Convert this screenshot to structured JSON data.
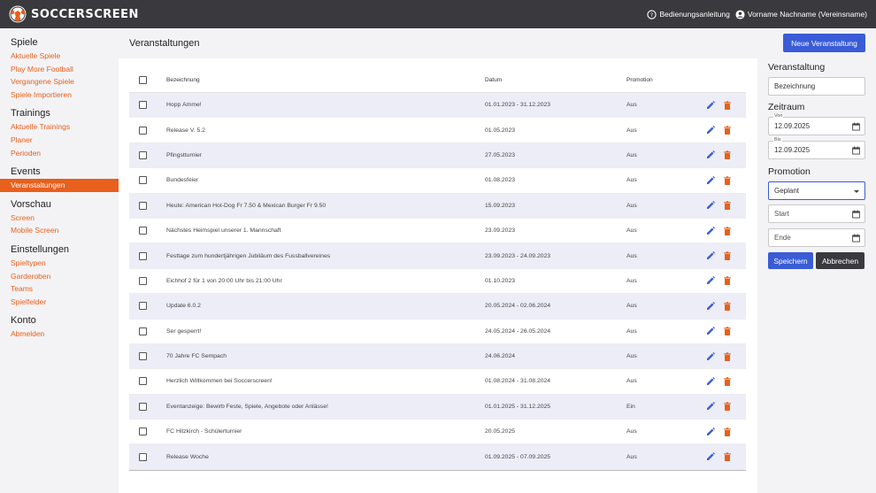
{
  "app": {
    "brand": "SOCCERSCREEN"
  },
  "topbar": {
    "manual": "Bedienungsanleitung",
    "user": "Vorname Nachname (Vereinsname)"
  },
  "sidebar": {
    "groups": [
      {
        "title": "Spiele",
        "items": [
          "Aktuelle Spiele",
          "Play More Football",
          "Vergangene Spiele",
          "Spiele Importieren"
        ]
      },
      {
        "title": "Trainings",
        "items": [
          "Aktuelle Trainings",
          "Planer",
          "Perioden"
        ]
      },
      {
        "title": "Events",
        "items": [
          "Veranstaltungen"
        ]
      },
      {
        "title": "Vorschau",
        "items": [
          "Screen",
          "Mobile Screen"
        ]
      },
      {
        "title": "Einstellungen",
        "items": [
          "Spieltypen",
          "Garderoben",
          "Teams",
          "Spielfelder"
        ]
      },
      {
        "title": "Konto",
        "items": [
          "Abmelden"
        ]
      }
    ]
  },
  "main": {
    "title": "Veranstaltungen",
    "new_button": "Neue Veranstaltung",
    "columns": {
      "name": "Bezeichnung",
      "date": "Datum",
      "promo": "Promotion"
    },
    "rows": [
      {
        "name": "Hopp Ämme!",
        "date": "01.01.2023 - 31.12.2023",
        "promo": "Aus"
      },
      {
        "name": "Release V. 5.2",
        "date": "01.05.2023",
        "promo": "Aus"
      },
      {
        "name": "Pfingstturnier",
        "date": "27.05.2023",
        "promo": "Aus"
      },
      {
        "name": "Bundesfeier",
        "date": "01.08.2023",
        "promo": "Aus"
      },
      {
        "name": "Heute: American Hot-Dog Fr 7.50 & Mexican Burger Fr 9.50",
        "date": "15.09.2023",
        "promo": "Aus"
      },
      {
        "name": "Nächstes Heimspiel unserer 1. Mannschaft",
        "date": "23.09.2023",
        "promo": "Aus"
      },
      {
        "name": "Festtage zum hundertjährigen Jubiläum des Fussballvereines",
        "date": "23.09.2023 - 24.09.2023",
        "promo": "Aus"
      },
      {
        "name": "Eichhof 2 für 1 von 20:00 Uhr bis 21:00 Uhr",
        "date": "01.10.2023",
        "promo": "Aus"
      },
      {
        "name": "Update 6.0.2",
        "date": "20.05.2024 - 02.06.2024",
        "promo": "Aus"
      },
      {
        "name": "Ser gesperrt!",
        "date": "24.05.2024 - 26.05.2024",
        "promo": "Aus"
      },
      {
        "name": "70 Jahre FC Sempach",
        "date": "24.06.2024",
        "promo": "Aus"
      },
      {
        "name": "Herzlich Willkommen bei Soccerscreen!",
        "date": "01.08.2024 - 31.08.2024",
        "promo": "Aus"
      },
      {
        "name": "Eventanzeige: Bewirb Feste, Spiele, Angebote oder Anlässe!",
        "date": "01.01.2025 - 31.12.2025",
        "promo": "Ein"
      },
      {
        "name": "FC Hitzkirch - Schülerturnier",
        "date": "20.05.2025",
        "promo": "Aus"
      },
      {
        "name": "Release Woche",
        "date": "01.09.2025 - 07.09.2025",
        "promo": "Aus"
      }
    ]
  },
  "form": {
    "heading": "Veranstaltung",
    "name_value": "Bezeichnung",
    "period_heading": "Zeitraum",
    "from_label": "Von",
    "from_value": "12.09.2025",
    "to_label": "Bis",
    "to_value": "12.09.2025",
    "promo_heading": "Promotion",
    "promo_value": "Geplant",
    "start_value": "Start",
    "end_value": "Ende",
    "save": "Speichern",
    "cancel": "Abbrechen"
  },
  "colors": {
    "accent": "#e8601c",
    "primary": "#3a5cd6",
    "topbar": "#3a3a3e",
    "edit": "#3a5cd6",
    "delete": "#e8601c"
  }
}
